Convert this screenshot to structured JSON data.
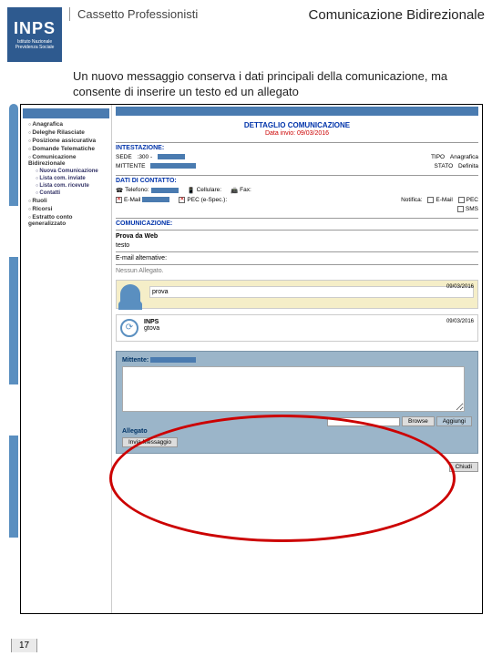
{
  "slide": {
    "page_number": "17"
  },
  "header": {
    "logo_text": "INPS",
    "logo_sub": "Istituto Nazionale Previdenza Sociale",
    "left_title": "Cassetto Professionisti",
    "right_title": "Comunicazione Bidirezionale"
  },
  "description": "Un nuovo messaggio conserva i dati principali della comunicazione, ma consente di inserire un testo ed un allegato",
  "sidebar": {
    "items": [
      "Anagrafica",
      "Deleghe Rilasciate",
      "Posizione assicurativa",
      "Domande Telematiche",
      "Comunicazione Bidirezionale"
    ],
    "sub_items": [
      "Nuova Comunicazione",
      "Lista com. inviate",
      "Lista com. ricevute",
      "Contatti"
    ],
    "items2": [
      "Ruoli",
      "Ricorsi",
      "Estratto conto generalizzato"
    ]
  },
  "detail": {
    "title": "DETTAGLIO COMUNICAZIONE",
    "date_line": "Data invio: 09/03/2016",
    "sec_intestazione": "INTESTAZIONE:",
    "sede_lbl": "SEDE",
    "sede_val": ":300 -",
    "tipo_lbl": "TIPO",
    "tipo_val": "Anagrafica",
    "mittente_lbl": "MITTENTE",
    "stato_lbl": "STATO",
    "stato_val": "Definita",
    "sec_contatto": "DATI DI CONTATTO:",
    "telefono": "Telefono:",
    "cellulare": "Cellulare:",
    "fax": "Fax:",
    "email": "E-Mail",
    "pec": "PEC (e-Spec.):",
    "notifica": "Notifica:",
    "not_email": "E-Mail",
    "not_pec": "PEC",
    "not_sms": "SMS",
    "sec_com": "COMUNICAZIONE:",
    "prova_da_web": "Prova da Web",
    "testo": "testo",
    "email_alt": "E-mail alternative:",
    "nessun_allegato": "Nessun Allegato.",
    "msg1_text": "prova",
    "msg1_date": "09/03/2016",
    "msg2_sender": "INPS",
    "msg2_text": "gtova",
    "msg2_date": "09/03/2016"
  },
  "compose": {
    "mittente": "Mittente:",
    "browse": "Browse",
    "aggiungi": "Aggiungi",
    "allegato": "Allegato",
    "invia": "Invia Messaggio",
    "chiudi": "Chiudi"
  }
}
